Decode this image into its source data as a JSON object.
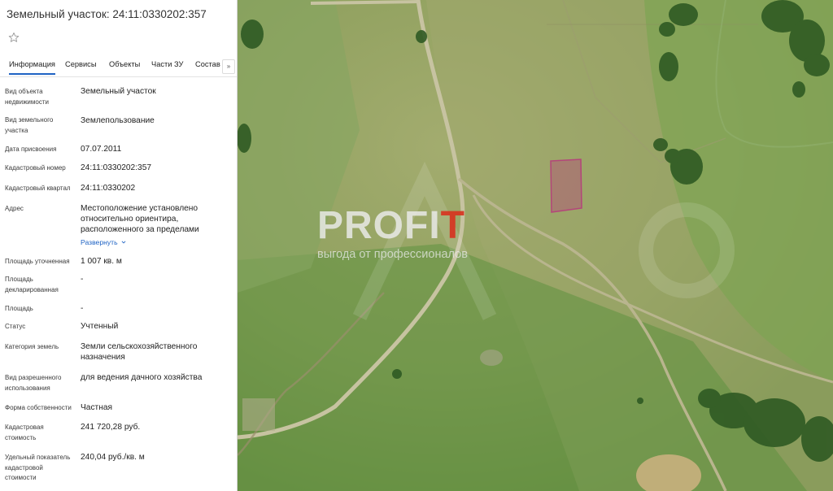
{
  "title": "Земельный участок: 24:11:0330202:357",
  "tabs": [
    "Информация",
    "Сервисы",
    "Объекты",
    "Части ЗУ",
    "Состав"
  ],
  "tab_more": "»",
  "fields": [
    {
      "label": "Вид объекта недвижимости",
      "value": "Земельный участок"
    },
    {
      "label": "Вид земельного участка",
      "value": "Землепользование"
    },
    {
      "label": "Дата присвоения",
      "value": "07.07.2011"
    },
    {
      "label": "Кадастровый номер",
      "value": "24:11:0330202:357"
    },
    {
      "label": "Кадастровый квартал",
      "value": "24:11:0330202"
    },
    {
      "label": "Адрес",
      "value": "Местоположение установлено относительно ориентира, расположенного за пределами"
    },
    {
      "label": "Площадь уточненная",
      "value": "1 007 кв. м"
    },
    {
      "label": "Площадь декларированная",
      "value": "-"
    },
    {
      "label": "Площадь",
      "value": "-"
    },
    {
      "label": "Статус",
      "value": "Учтенный"
    },
    {
      "label": "Категория земель",
      "value": "Земли сельскохозяйственного назначения"
    },
    {
      "label": "Вид разрешенного использования",
      "value": "для ведения дачного хозяйства"
    },
    {
      "label": "Форма собственности",
      "value": "Частная"
    },
    {
      "label": "Кадастровая стоимость",
      "value": "241 720,28 руб."
    },
    {
      "label": "Удельный показатель кадастровой стоимости",
      "value": "240,04 руб./кв. м"
    }
  ],
  "expand_label": "Развернуть",
  "watermark": {
    "brand_a": "PROFI",
    "brand_b": "T",
    "tagline": "выгода от профессионалов"
  },
  "colors": {
    "accent": "#1f63c4",
    "parcel": "#b4457a",
    "watermark_red": "#d7321e"
  }
}
